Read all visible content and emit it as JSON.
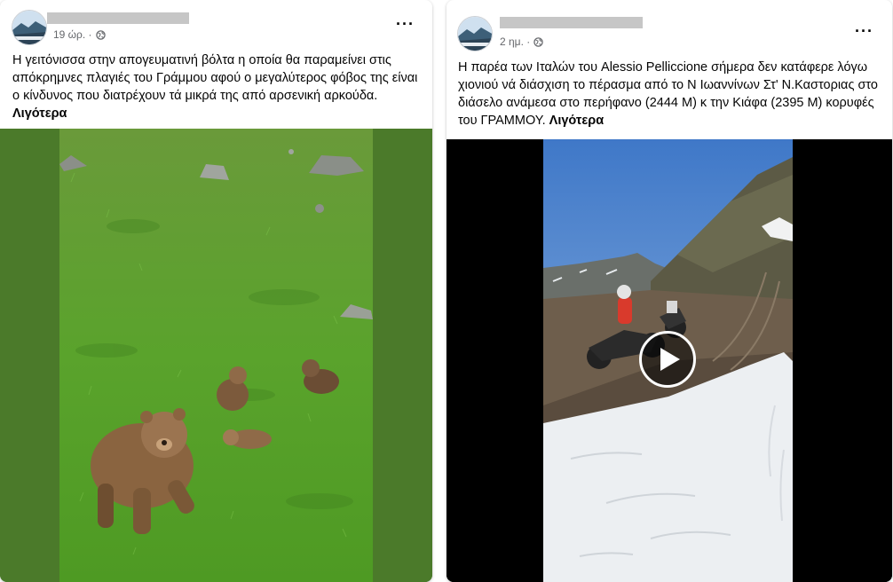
{
  "posts": [
    {
      "time": "19 ώρ. ·",
      "text": "Η γειτόνισσα στην απογευματινή βόλτα η οποία θα παραμείνει στις απόκρημνες πλαγιές του Γράμμου αφού ο μεγαλύτερος φόβος της είναι ο κίνδυνος που διατρέχουν τά μικρά της από αρσενική αρκούδα.",
      "more": "Λιγότερα",
      "media_type": "photo",
      "icons": [
        "globe-icon",
        "more-options-icon"
      ]
    },
    {
      "time": "2 ημ. ·",
      "text": "Η παρέα των Ιταλών του Alessio Pelliccione  σήμερα δεν κατάφερε λόγω χιονιού νά διάσχιση το πέρασμα από το Ν Ιωαννίνων Στ' Ν.Καστοριας στο διάσελο ανάμεσα στο περήφανο (2444 Μ) κ την Κιάφα (2395 Μ) κορυφές του ΓΡΑΜΜΟΥ.",
      "more": "Λιγότερα",
      "media_type": "video",
      "icons": [
        "globe-icon",
        "more-options-icon",
        "play-icon"
      ]
    }
  ],
  "colors": {
    "text": "#050505",
    "meta": "#65676b",
    "grass": "#4b7a2a",
    "video_bg": "#000000"
  }
}
